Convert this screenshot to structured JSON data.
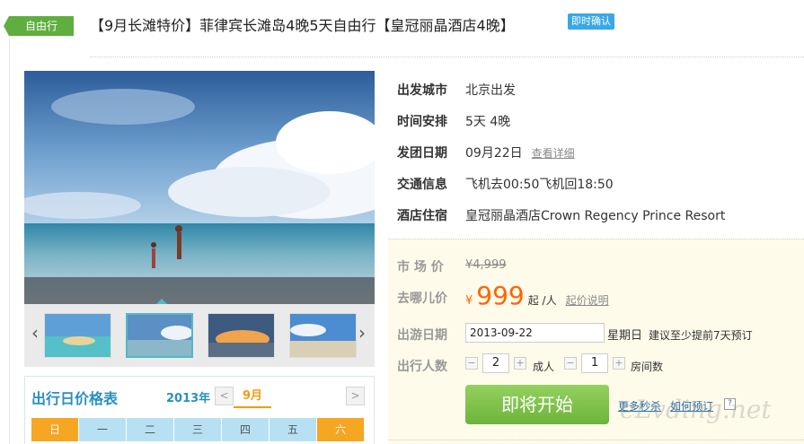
{
  "header": {
    "tag": "自由行",
    "title": "【9月长滩特价】菲律宾长滩岛4晚5天自由行【皇冠丽晶酒店4晚】",
    "badge": "即时确认"
  },
  "gallery": {
    "prev_icon": "chevron-left-icon",
    "next_icon": "chevron-right-icon"
  },
  "calendar": {
    "title": "出行日价格表",
    "year": "2013年",
    "month": "9月",
    "prev": "<",
    "next": ">",
    "weekdays": [
      "日",
      "一",
      "二",
      "三",
      "四",
      "五",
      "六"
    ]
  },
  "info": [
    {
      "label": "出发城市",
      "value": "北京出发"
    },
    {
      "label": "时间安排",
      "value": "5天 4晚"
    },
    {
      "label": "发团日期",
      "value": "09月22日",
      "link": "查看详细"
    },
    {
      "label": "交通信息",
      "value": "飞机去00:50飞机回18:50"
    },
    {
      "label": "酒店住宿",
      "value": "皇冠丽晶酒店Crown Regency Prince Resort"
    }
  ],
  "price": {
    "market_label": "市 场 价",
    "market_value": "¥4,999",
    "qunar_label": "去哪儿价",
    "currency": "¥",
    "amount": "999",
    "unit": "起 /人",
    "note": "起价说明",
    "date_label": "出游日期",
    "date_value": "2013-09-22",
    "weekday": "星期日",
    "tip": "建议至少提前7天预订",
    "people_label": "出行人数",
    "adults": "2",
    "adults_unit": "成人",
    "rooms": "1",
    "rooms_unit": "房间数",
    "minus": "−",
    "plus": "+",
    "cta": "即将开始",
    "link_more": "更多秒杀",
    "link_how": "如何预订",
    "help": "?"
  },
  "watermark": "eLvding.net",
  "colors": {
    "tag_green": "#5fae3f",
    "badge_blue": "#39a8e6",
    "price_orange": "#ff6600",
    "calendar_blue": "#2a8fc1",
    "weekend_orange": "#f5a623",
    "cta_green": "#6db43a"
  }
}
